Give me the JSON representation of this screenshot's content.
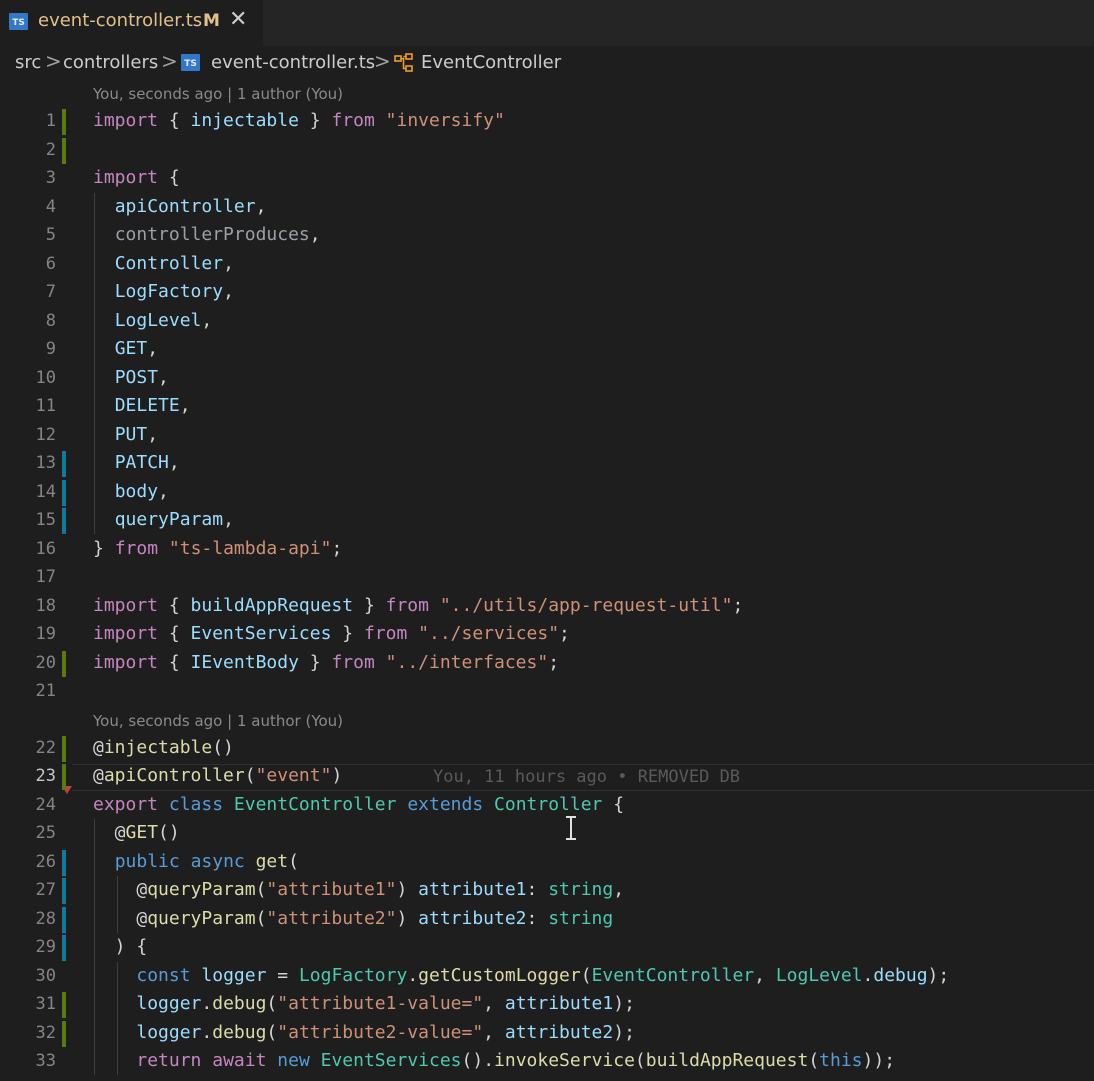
{
  "tab": {
    "title": "event-controller.ts",
    "modified": "M",
    "close": "✕",
    "icon": "TS"
  },
  "breadcrumb": {
    "src": "src",
    "controllers": "controllers",
    "file": "event-controller.ts",
    "symbol": "EventController",
    "sep": ">"
  },
  "codelens": [
    "You, seconds ago | 1 author (You)",
    "You, seconds ago | 1 author (You)"
  ],
  "blame": "You, 11 hours ago • REMOVED DB",
  "colors": {
    "keyword": "#c586c0",
    "string": "#ce9178",
    "variable": "#9cdcfe",
    "type": "#4ec9b0",
    "function": "#dcdcaa",
    "storage": "#569cd6",
    "added": "#587c0c",
    "modified": "#0c7d9d",
    "tab_text": "#e2c08d"
  },
  "lines": [
    {
      "n": "1",
      "parts": [
        [
          "k",
          "import"
        ],
        [
          "p",
          " { "
        ],
        [
          "v",
          "injectable"
        ],
        [
          "p",
          " } "
        ],
        [
          "k",
          "from"
        ],
        [
          "p",
          " "
        ],
        [
          "s",
          "\"inversify\""
        ]
      ]
    },
    {
      "n": "2",
      "parts": []
    },
    {
      "n": "3",
      "parts": [
        [
          "k",
          "import"
        ],
        [
          "p",
          " {"
        ]
      ]
    },
    {
      "n": "4",
      "parts": [
        [
          "p",
          "  "
        ],
        [
          "v",
          "apiController"
        ],
        [
          "p",
          ","
        ]
      ]
    },
    {
      "n": "5",
      "parts": [
        [
          "p",
          "  "
        ],
        [
          "g",
          "controllerProduces"
        ],
        [
          "p",
          ","
        ]
      ]
    },
    {
      "n": "6",
      "parts": [
        [
          "p",
          "  "
        ],
        [
          "v",
          "Controller"
        ],
        [
          "p",
          ","
        ]
      ]
    },
    {
      "n": "7",
      "parts": [
        [
          "p",
          "  "
        ],
        [
          "v",
          "LogFactory"
        ],
        [
          "p",
          ","
        ]
      ]
    },
    {
      "n": "8",
      "parts": [
        [
          "p",
          "  "
        ],
        [
          "v",
          "LogLevel"
        ],
        [
          "p",
          ","
        ]
      ]
    },
    {
      "n": "9",
      "parts": [
        [
          "p",
          "  "
        ],
        [
          "v",
          "GET"
        ],
        [
          "p",
          ","
        ]
      ]
    },
    {
      "n": "10",
      "parts": [
        [
          "p",
          "  "
        ],
        [
          "v",
          "POST"
        ],
        [
          "p",
          ","
        ]
      ]
    },
    {
      "n": "11",
      "parts": [
        [
          "p",
          "  "
        ],
        [
          "v",
          "DELETE"
        ],
        [
          "p",
          ","
        ]
      ]
    },
    {
      "n": "12",
      "parts": [
        [
          "p",
          "  "
        ],
        [
          "v",
          "PUT"
        ],
        [
          "p",
          ","
        ]
      ]
    },
    {
      "n": "13",
      "parts": [
        [
          "p",
          "  "
        ],
        [
          "v",
          "PATCH"
        ],
        [
          "p",
          ","
        ]
      ]
    },
    {
      "n": "14",
      "parts": [
        [
          "p",
          "  "
        ],
        [
          "v",
          "body"
        ],
        [
          "p",
          ","
        ]
      ]
    },
    {
      "n": "15",
      "parts": [
        [
          "p",
          "  "
        ],
        [
          "v",
          "queryParam"
        ],
        [
          "p",
          ","
        ]
      ]
    },
    {
      "n": "16",
      "parts": [
        [
          "p",
          "} "
        ],
        [
          "k",
          "from"
        ],
        [
          "p",
          " "
        ],
        [
          "s",
          "\"ts-lambda-api\""
        ],
        [
          "p",
          ";"
        ]
      ]
    },
    {
      "n": "17",
      "parts": []
    },
    {
      "n": "18",
      "parts": [
        [
          "k",
          "import"
        ],
        [
          "p",
          " { "
        ],
        [
          "v",
          "buildAppRequest"
        ],
        [
          "p",
          " } "
        ],
        [
          "k",
          "from"
        ],
        [
          "p",
          " "
        ],
        [
          "s",
          "\"../utils/app-request-util\""
        ],
        [
          "p",
          ";"
        ]
      ]
    },
    {
      "n": "19",
      "parts": [
        [
          "k",
          "import"
        ],
        [
          "p",
          " { "
        ],
        [
          "v",
          "EventServices"
        ],
        [
          "p",
          " } "
        ],
        [
          "k",
          "from"
        ],
        [
          "p",
          " "
        ],
        [
          "s",
          "\"../services\""
        ],
        [
          "p",
          ";"
        ]
      ]
    },
    {
      "n": "20",
      "parts": [
        [
          "k",
          "import"
        ],
        [
          "p",
          " { "
        ],
        [
          "v",
          "IEventBody"
        ],
        [
          "p",
          " } "
        ],
        [
          "k",
          "from"
        ],
        [
          "p",
          " "
        ],
        [
          "s",
          "\"../interfaces\""
        ],
        [
          "p",
          ";"
        ]
      ]
    },
    {
      "n": "21",
      "parts": []
    },
    {
      "n": "22",
      "parts": [
        [
          "p",
          "@"
        ],
        [
          "f",
          "injectable"
        ],
        [
          "p",
          "()"
        ]
      ]
    },
    {
      "n": "23",
      "parts": [
        [
          "p",
          "@"
        ],
        [
          "f",
          "apiController"
        ],
        [
          "p",
          "("
        ],
        [
          "s",
          "\"event\""
        ],
        [
          "p",
          ")"
        ]
      ]
    },
    {
      "n": "24",
      "parts": [
        [
          "k",
          "export"
        ],
        [
          "p",
          " "
        ],
        [
          "kb",
          "class"
        ],
        [
          "p",
          " "
        ],
        [
          "t",
          "EventController"
        ],
        [
          "p",
          " "
        ],
        [
          "kb",
          "extends"
        ],
        [
          "p",
          " "
        ],
        [
          "t",
          "Controller"
        ],
        [
          "p",
          " {"
        ]
      ]
    },
    {
      "n": "25",
      "parts": [
        [
          "p",
          "  @"
        ],
        [
          "f",
          "GET"
        ],
        [
          "p",
          "()"
        ]
      ]
    },
    {
      "n": "26",
      "parts": [
        [
          "p",
          "  "
        ],
        [
          "kb",
          "public"
        ],
        [
          "p",
          " "
        ],
        [
          "kb",
          "async"
        ],
        [
          "p",
          " "
        ],
        [
          "f",
          "get"
        ],
        [
          "p",
          "("
        ]
      ]
    },
    {
      "n": "27",
      "parts": [
        [
          "p",
          "    @"
        ],
        [
          "f",
          "queryParam"
        ],
        [
          "p",
          "("
        ],
        [
          "s",
          "\"attribute1\""
        ],
        [
          "p",
          ") "
        ],
        [
          "v",
          "attribute1"
        ],
        [
          "p",
          ": "
        ],
        [
          "t",
          "string"
        ],
        [
          "p",
          ","
        ]
      ]
    },
    {
      "n": "28",
      "parts": [
        [
          "p",
          "    @"
        ],
        [
          "f",
          "queryParam"
        ],
        [
          "p",
          "("
        ],
        [
          "s",
          "\"attribute2\""
        ],
        [
          "p",
          ") "
        ],
        [
          "v",
          "attribute2"
        ],
        [
          "p",
          ": "
        ],
        [
          "t",
          "string"
        ]
      ]
    },
    {
      "n": "29",
      "parts": [
        [
          "p",
          "  ) {"
        ]
      ]
    },
    {
      "n": "30",
      "parts": [
        [
          "p",
          "    "
        ],
        [
          "kb",
          "const"
        ],
        [
          "p",
          " "
        ],
        [
          "v",
          "logger"
        ],
        [
          "p",
          " = "
        ],
        [
          "t",
          "LogFactory"
        ],
        [
          "p",
          "."
        ],
        [
          "f",
          "getCustomLogger"
        ],
        [
          "p",
          "("
        ],
        [
          "t",
          "EventController"
        ],
        [
          "p",
          ", "
        ],
        [
          "t",
          "LogLevel"
        ],
        [
          "p",
          "."
        ],
        [
          "v",
          "debug"
        ],
        [
          "p",
          ");"
        ]
      ]
    },
    {
      "n": "31",
      "parts": [
        [
          "p",
          "    "
        ],
        [
          "v",
          "logger"
        ],
        [
          "p",
          "."
        ],
        [
          "f",
          "debug"
        ],
        [
          "p",
          "("
        ],
        [
          "s",
          "\"attribute1-value=\""
        ],
        [
          "p",
          ", "
        ],
        [
          "v",
          "attribute1"
        ],
        [
          "p",
          ");"
        ]
      ]
    },
    {
      "n": "32",
      "parts": [
        [
          "p",
          "    "
        ],
        [
          "v",
          "logger"
        ],
        [
          "p",
          "."
        ],
        [
          "f",
          "debug"
        ],
        [
          "p",
          "("
        ],
        [
          "s",
          "\"attribute2-value=\""
        ],
        [
          "p",
          ", "
        ],
        [
          "v",
          "attribute2"
        ],
        [
          "p",
          ");"
        ]
      ]
    },
    {
      "n": "33",
      "parts": [
        [
          "p",
          "    "
        ],
        [
          "k",
          "return"
        ],
        [
          "p",
          " "
        ],
        [
          "k",
          "await"
        ],
        [
          "p",
          " "
        ],
        [
          "kb",
          "new"
        ],
        [
          "p",
          " "
        ],
        [
          "t",
          "EventServices"
        ],
        [
          "p",
          "()."
        ],
        [
          "f",
          "invokeService"
        ],
        [
          "p",
          "("
        ],
        [
          "f",
          "buildAppRequest"
        ],
        [
          "p",
          "("
        ],
        [
          "kb",
          "this"
        ],
        [
          "p",
          "));"
        ]
      ]
    }
  ]
}
